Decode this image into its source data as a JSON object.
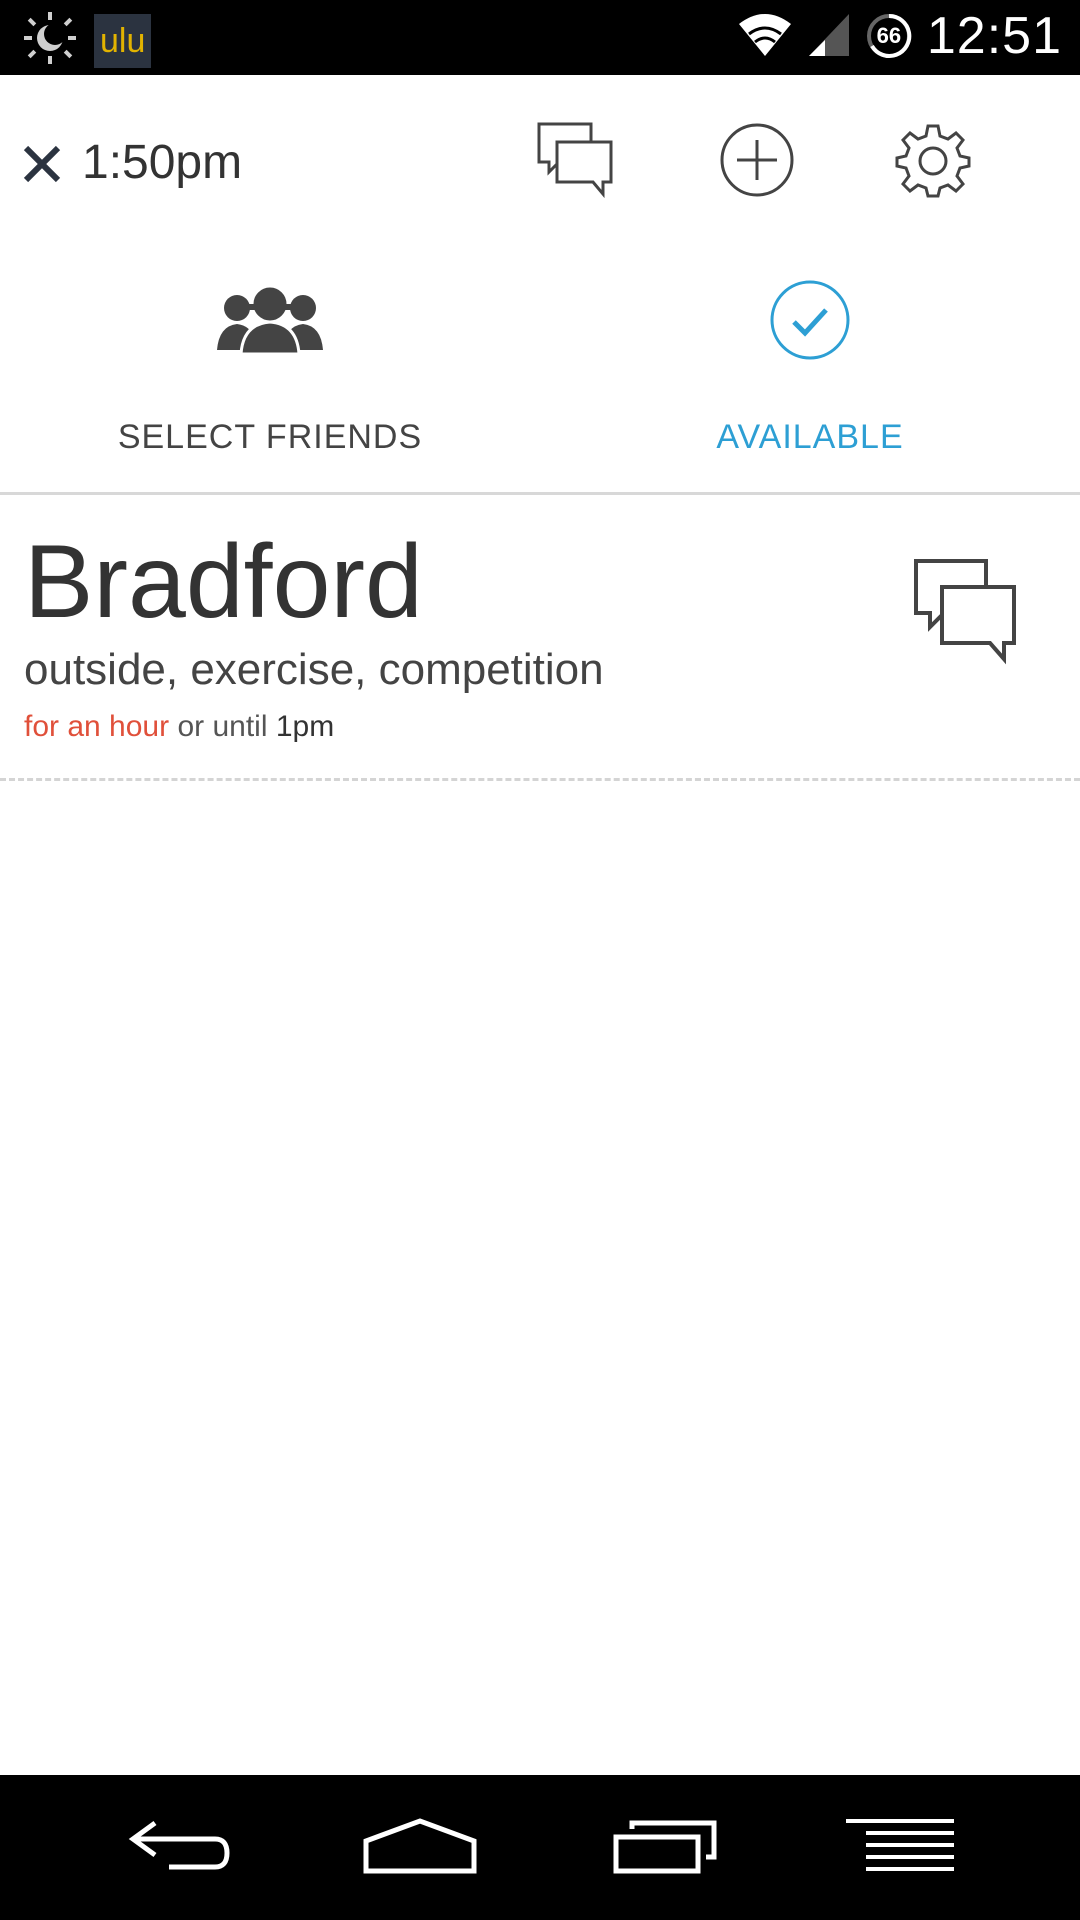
{
  "status_bar": {
    "app_badge": "ulu",
    "time": "12:51",
    "battery_level": "66",
    "icons": [
      "brightness-icon",
      "wifi-icon",
      "signal-icon",
      "battery-icon"
    ]
  },
  "toolbar": {
    "time_label": "1:50pm",
    "icons": [
      "close-icon",
      "chat-icon",
      "add-icon",
      "gear-icon"
    ]
  },
  "actions": {
    "select_friends_label": "SELECT FRIENDS",
    "available_label": "AVAILABLE"
  },
  "entry": {
    "name": "Bradford",
    "tags": "outside, exercise, competition",
    "duration": "for an hour",
    "connector": "or until",
    "until_time": "1pm"
  },
  "colors": {
    "accent": "#2d9fd4",
    "duration": "#e0503a",
    "text_dark": "#333333"
  },
  "nav_bar": {
    "icons": [
      "back-icon",
      "home-icon",
      "recents-icon",
      "menu-icon"
    ]
  }
}
